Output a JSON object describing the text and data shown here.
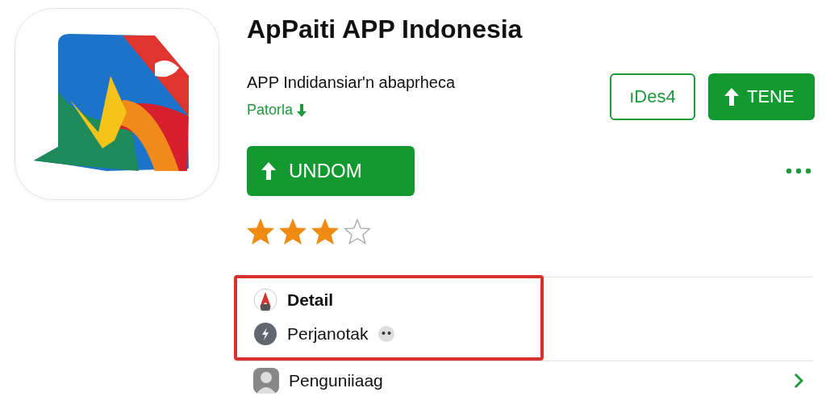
{
  "app": {
    "title": "ApPaiti APP Indonesia",
    "subtitle": "APP Indidansiar'n abaprheca",
    "developer": "Patorla"
  },
  "actions": [
    {
      "label": "ıDes4",
      "kind": "outline"
    },
    {
      "label": "TENE",
      "kind": "filled"
    }
  ],
  "install_button": {
    "label": "UNDOM"
  },
  "rating": {
    "stars": 3
  },
  "detail_section": {
    "highlighted": true,
    "rows": [
      {
        "label": "Detail",
        "kind": "heading"
      },
      {
        "label": "Perjanotak",
        "kind": "item"
      }
    ]
  },
  "list_rows": [
    {
      "label": "Penguniiaag",
      "kind": "link"
    }
  ]
}
